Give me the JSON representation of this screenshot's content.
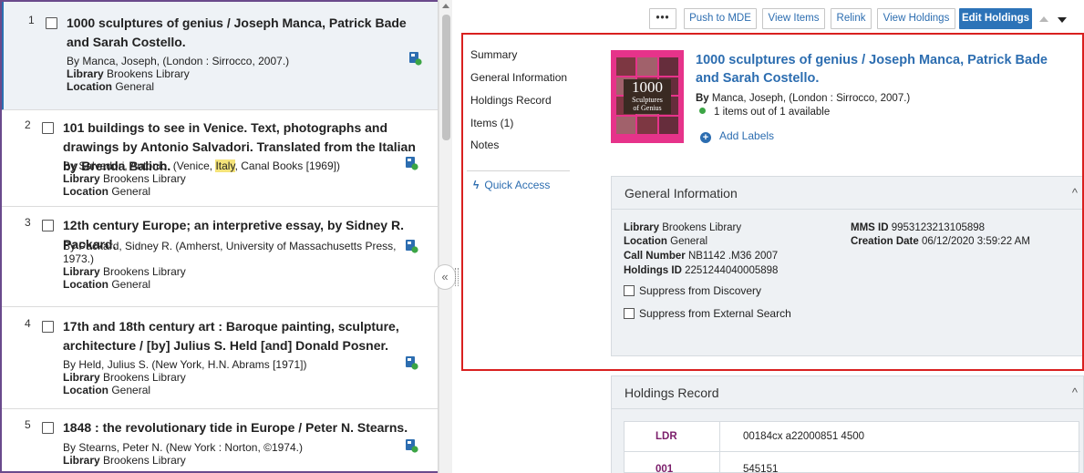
{
  "results": [
    {
      "num": "1",
      "title": "1000 sculptures of genius / Joseph Manca, Patrick Bade and Sarah Costello.",
      "by_label": "By",
      "by": "Manca, Joseph, (London : Sirrocco, 2007.)",
      "library_label": "Library",
      "library": "Brookens Library",
      "location_label": "Location",
      "location": "General"
    },
    {
      "num": "2",
      "title": "101 buildings to see in Venice. Text, photographs and drawings by Antonio Salvadori. Translated from the Italian by Brenda Balich.",
      "by_label": "By",
      "by_pre": "Salvadori, Antonio. (Venice, ",
      "by_hl": "Italy",
      "by_post": ", Canal Books [1969])",
      "library_label": "Library",
      "library": "Brookens Library",
      "location_label": "Location",
      "location": "General"
    },
    {
      "num": "3",
      "title": "12th century Europe; an interpretive essay, by Sidney R. Packard.",
      "by_label": "By",
      "by": "Packard, Sidney R. (Amherst, University of Massachusetts Press,",
      "by2": "1973.)",
      "library_label": "Library",
      "library": "Brookens Library",
      "location_label": "Location",
      "location": "General"
    },
    {
      "num": "4",
      "title": "17th and 18th century art : Baroque painting, sculpture, architecture / [by] Julius S. Held [and] Donald Posner.",
      "by_label": "By",
      "by": "Held, Julius S. (New York, H.N. Abrams [1971])",
      "library_label": "Library",
      "library": "Brookens Library",
      "location_label": "Location",
      "location": "General"
    },
    {
      "num": "5",
      "title": "1848 : the revolutionary tide in Europe / Peter N. Stearns.",
      "by_label": "By",
      "by": "Stearns, Peter N. (New York : Norton, ©1974.)",
      "library_label": "Library",
      "library": "Brookens Library"
    }
  ],
  "splitter": {
    "collapse_glyph": "«"
  },
  "toolbar": {
    "more": "•••",
    "push_to_mde": "Push to MDE",
    "view_items": "View Items",
    "relink": "Relink",
    "view_holdings": "View Holdings",
    "edit_holdings": "Edit Holdings"
  },
  "section_nav": {
    "summary": "Summary",
    "general_information": "General Information",
    "holdings_record": "Holdings Record",
    "items": "Items (1)",
    "notes": "Notes",
    "quick_access": "Quick Access"
  },
  "record": {
    "cover_number": "1000",
    "cover_text_1": "Sculptures",
    "cover_text_2": "of Genius",
    "title": "1000 sculptures of genius / Joseph Manca, Patrick Bade and Sarah Costello.",
    "by_label": "By",
    "by": "Manca, Joseph, (London : Sirrocco, 2007.)",
    "availability": "1 items out of 1 available",
    "add_labels": "Add Labels"
  },
  "general_information": {
    "heading": "General Information",
    "library_label": "Library",
    "library": "Brookens Library",
    "location_label": "Location",
    "location": "General",
    "call_number_label": "Call Number",
    "call_number": "NB1142 .M36 2007",
    "holdings_id_label": "Holdings ID",
    "holdings_id": "2251244040005898",
    "mms_id_label": "MMS ID",
    "mms_id": "9953123213105898",
    "creation_date_label": "Creation Date",
    "creation_date": "06/12/2020 3:59:22 AM",
    "suppress_discovery": "Suppress from Discovery",
    "suppress_external": "Suppress from External Search"
  },
  "holdings_record": {
    "heading": "Holdings Record",
    "rows": [
      {
        "tag": "LDR",
        "value": "00184cx a22000851 4500"
      },
      {
        "tag": "001",
        "value": "545151"
      }
    ]
  },
  "colors": {
    "link": "#2c6db0",
    "primary_button": "#2c73b8",
    "highlight_box": "#d9201f",
    "available_dot": "#3ca545",
    "marc_tag": "#7b1e6b",
    "selected_bar": "#2b6fb0"
  }
}
